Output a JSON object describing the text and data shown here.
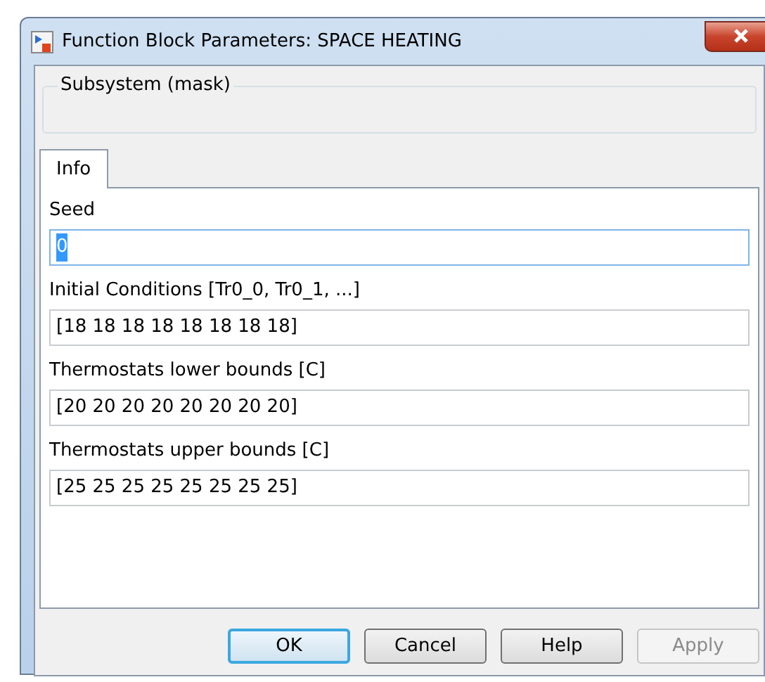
{
  "window": {
    "title": "Function Block Parameters: SPACE HEATING"
  },
  "group": {
    "title": "Subsystem (mask)"
  },
  "tabs": [
    {
      "label": "Info",
      "selected": true
    }
  ],
  "fields": [
    {
      "label": "Seed",
      "value": "0",
      "focused": true
    },
    {
      "label": "Initial Conditions [Tr0_0, Tr0_1, ...]",
      "value": "[18 18 18 18 18 18 18 18]",
      "focused": false
    },
    {
      "label": "Thermostats lower bounds [C]",
      "value": "[20 20 20 20 20 20 20 20]",
      "focused": false
    },
    {
      "label": "Thermostats upper bounds [C]",
      "value": "[25 25 25 25 25 25 25 25]",
      "focused": false
    }
  ],
  "buttons": [
    {
      "label": "OK",
      "default": true,
      "disabled": false
    },
    {
      "label": "Cancel",
      "default": false,
      "disabled": false
    },
    {
      "label": "Help",
      "default": false,
      "disabled": false
    },
    {
      "label": "Apply",
      "default": false,
      "disabled": true
    }
  ]
}
